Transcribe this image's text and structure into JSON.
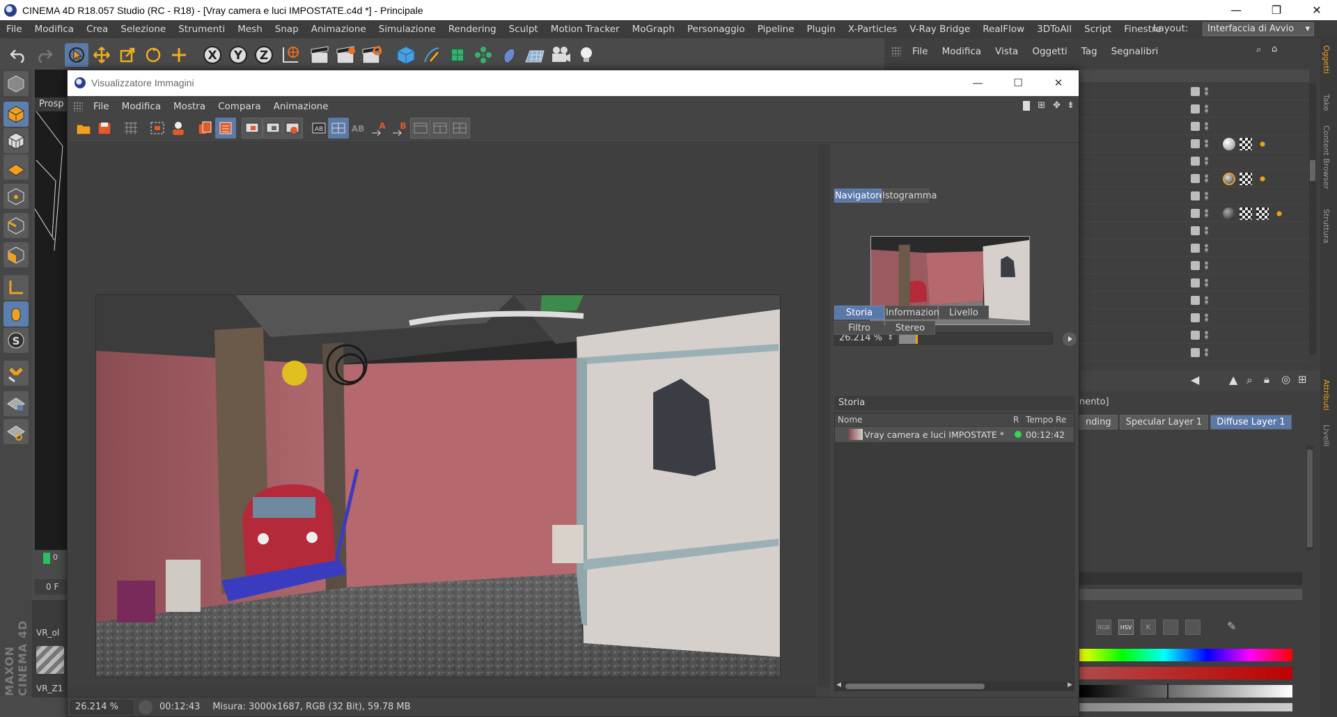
{
  "window": {
    "title": "CINEMA 4D R18.057 Studio (RC - R18) - [Vray camera e luci IMPOSTATE.c4d *] - Principale",
    "minimize": "—",
    "maximize": "❐",
    "close": "✕"
  },
  "menubar": {
    "items": [
      "File",
      "Modifica",
      "Crea",
      "Selezione",
      "Strumenti",
      "Mesh",
      "Snap",
      "Animazione",
      "Simulazione",
      "Rendering",
      "Sculpt",
      "Motion Tracker",
      "MoGraph",
      "Personaggio",
      "Pipeline",
      "Plugin",
      "X-Particles",
      "V-Ray Bridge",
      "RealFlow",
      "3DToAll",
      "Script",
      "Finestre"
    ],
    "layout_label": "Layout:",
    "layout_value": "Interfaccia di Avvio"
  },
  "viewport": {
    "tab_label": "Prosp",
    "frame_value": "0 F",
    "frame_counter": "0"
  },
  "materials": {
    "item1": "VR_ol",
    "item2": "VR_Z1"
  },
  "brand": "MAXON CINEMA 4D",
  "object_manager": {
    "menu": [
      "File",
      "Modifica",
      "Vista",
      "Oggetti",
      "Tag",
      "Segnalibri"
    ]
  },
  "attributes": {
    "subtitle": "nento]",
    "tabs": [
      "nding",
      "Specular Layer 1",
      "Diffuse Layer 1"
    ],
    "color_modes": [
      "RGB",
      "HSV",
      "K"
    ]
  },
  "side_tabs": [
    "Oggetti",
    "Take",
    "Content Browser",
    "Struttura",
    "Attributi",
    "Livelli"
  ],
  "dialog": {
    "title": "Visualizzatore Immagini",
    "menu": [
      "File",
      "Modifica",
      "Mostra",
      "Compara",
      "Animazione"
    ],
    "nav_tabs": [
      "Navigatore",
      "Istogramma"
    ],
    "zoom": "26.214 %",
    "zoom_fraction": 0.11,
    "panel_tabs_row1": [
      "Storia",
      "Informazioni",
      "Livello"
    ],
    "panel_tabs_row2": [
      "Filtro",
      "Stereo"
    ],
    "history_label": "Storia",
    "history_columns": [
      "Nome",
      "R",
      "Tempo Re"
    ],
    "history_rows": [
      {
        "name": "Vray camera e luci IMPOSTATE *",
        "time": "00:12:42",
        "status_color": "#36d45a"
      }
    ],
    "status": {
      "zoom": "26.214 %",
      "time": "00:12:43",
      "info": "Misura: 3000x1687, RGB (32 Bit), 59.78 MB"
    }
  },
  "colors": {
    "accent": "#5a78a8",
    "highlight": "#f0a020",
    "panel": "#444444"
  }
}
